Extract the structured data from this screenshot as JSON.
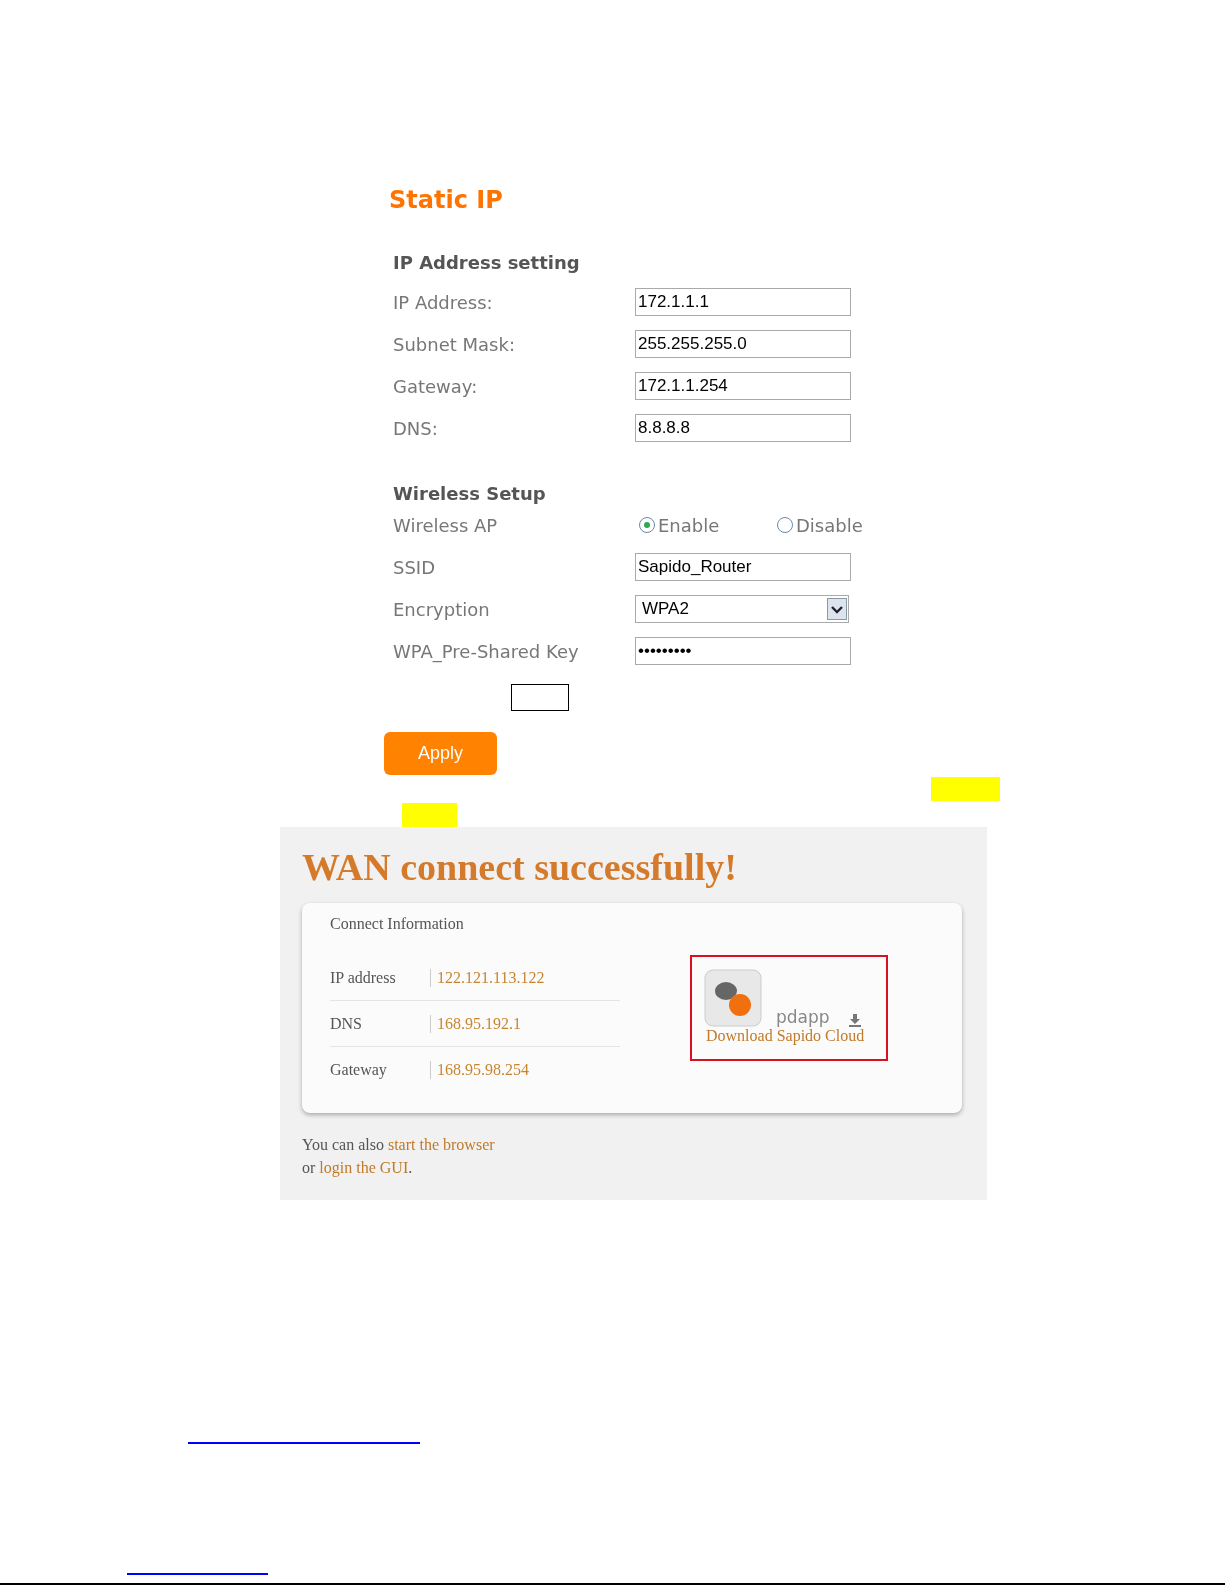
{
  "static_ip": {
    "title": "Static IP",
    "ip_section": {
      "heading": "IP Address setting",
      "fields": [
        {
          "label": "IP Address:",
          "value": "172.1.1.1"
        },
        {
          "label": "Subnet Mask:",
          "value": "255.255.255.0"
        },
        {
          "label": "Gateway:",
          "value": "172.1.1.254"
        },
        {
          "label": "DNS:",
          "value": "8.8.8.8"
        }
      ]
    },
    "wireless_section": {
      "heading": "Wireless Setup",
      "rows": [
        {
          "kind": "radio",
          "label": "Wireless AP",
          "options": [
            {
              "label": "Enable",
              "selected": true
            },
            {
              "label": "Disable",
              "selected": false
            }
          ]
        },
        {
          "kind": "text",
          "label": "SSID",
          "value": "Sapido_Router"
        },
        {
          "kind": "select",
          "label": "Encryption",
          "value": "WPA2"
        },
        {
          "kind": "password",
          "label": "WPA_Pre-Shared Key",
          "value": "•••••••••"
        }
      ]
    },
    "apply_button": "Apply"
  },
  "wan_screen": {
    "title": "WAN connect successfully!",
    "card_title": "Connect Information",
    "rows": [
      {
        "label": "IP address",
        "value": "122.121.113.122"
      },
      {
        "label": "DNS",
        "value": "168.95.192.1"
      },
      {
        "label": "Gateway",
        "value": "168.95.98.254"
      }
    ],
    "app": {
      "name": "pdapp",
      "link": "Download Sapido Cloud"
    },
    "footer": [
      {
        "before": "You can also ",
        "link": "start the browser"
      },
      {
        "before": "or ",
        "link": "login the GUI",
        "after": "."
      }
    ]
  }
}
